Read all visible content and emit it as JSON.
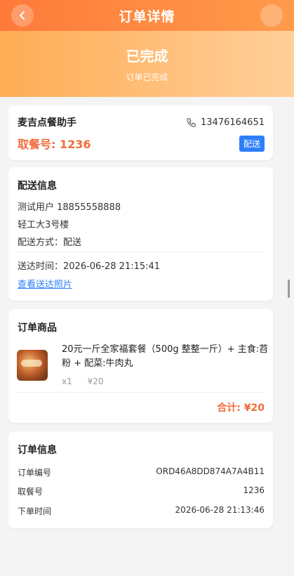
{
  "header": {
    "title": "订单详情"
  },
  "hero": {
    "status": "已完成",
    "subtitle": "订单已完成"
  },
  "store": {
    "name": "麦吉点餐助手",
    "phone": "13476164651",
    "pickup_label": "取餐号:",
    "pickup_no": "1236",
    "tag": "配送"
  },
  "delivery": {
    "title": "配送信息",
    "user": "测试用户 18855558888",
    "address": "轻工大3号楼",
    "method": "配送方式：配送",
    "time": "送达时间：2026-06-28 21:15:41",
    "photo_link": "查看送达照片"
  },
  "items": {
    "title": "订单商品",
    "list": [
      {
        "name": "20元一斤全家福套餐（500g 整整一斤）+ 主食:苕粉 + 配菜:牛肉丸",
        "qty": "x1",
        "price": "¥20"
      }
    ],
    "total": "合计: ¥20"
  },
  "order_info": {
    "title": "订单信息",
    "rows": [
      {
        "label": "订单编号",
        "value": "ORD46A8DD874A7A4B11"
      },
      {
        "label": "取餐号",
        "value": "1236"
      },
      {
        "label": "下单时间",
        "value": "2026-06-28 21:13:46"
      }
    ]
  },
  "icons": {
    "back": "back-arrow-icon",
    "phone": "phone-icon"
  },
  "colors": {
    "accent": "#f26b3a",
    "tag_blue": "#2d7ff9",
    "header_start": "#ff7a3a"
  }
}
